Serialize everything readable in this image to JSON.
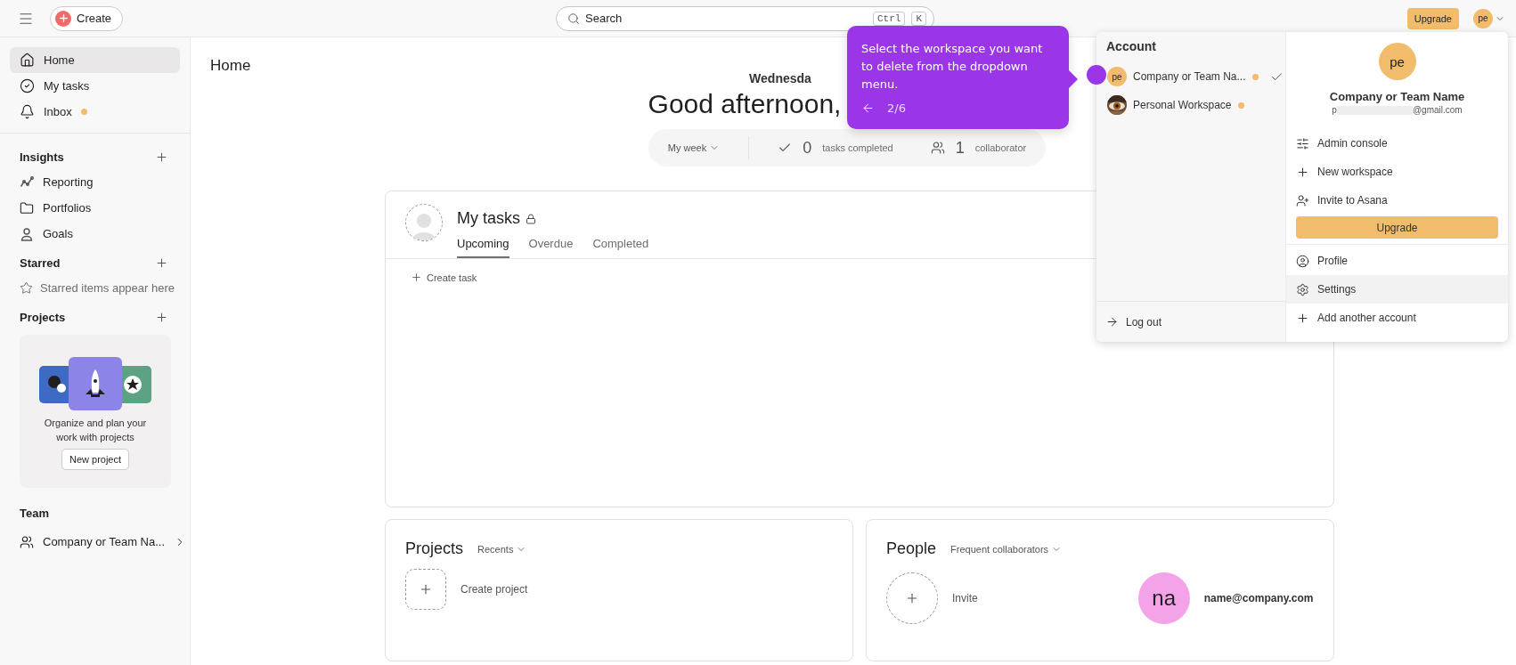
{
  "topbar": {
    "create": "Create",
    "search": {
      "placeholder": "Search",
      "keys": [
        "Ctrl",
        "K"
      ]
    },
    "upgrade": "Upgrade",
    "avatar": "pe"
  },
  "sidebar": {
    "nav": [
      {
        "label": "Home",
        "selected": true,
        "dot": false
      },
      {
        "label": "My tasks",
        "selected": false,
        "dot": false
      },
      {
        "label": "Inbox",
        "selected": false,
        "dot": true
      }
    ],
    "insights": {
      "title": "Insights",
      "items": [
        {
          "label": "Reporting"
        },
        {
          "label": "Portfolios"
        },
        {
          "label": "Goals"
        }
      ]
    },
    "starred": {
      "title": "Starred",
      "empty": "Starred items appear here"
    },
    "projects": {
      "title": "Projects",
      "promo": "Organize and plan your work with projects",
      "button": "New project"
    },
    "team": {
      "title": "Team",
      "item": "Company or Team Na..."
    }
  },
  "main": {
    "title": "Home",
    "date": "Wednesda",
    "greeting": "Good afternoon,",
    "stats": {
      "period": "My week",
      "tasks_count": "0",
      "tasks_label": "tasks completed",
      "collab_count": "1",
      "collab_label": "collaborator"
    }
  },
  "tasks_card": {
    "title": "My tasks",
    "tabs": [
      {
        "label": "Upcoming",
        "selected": true
      },
      {
        "label": "Overdue",
        "selected": false
      },
      {
        "label": "Completed",
        "selected": false
      }
    ],
    "create": "Create task"
  },
  "projects_card": {
    "title": "Projects",
    "filter": "Recents",
    "create": "Create project"
  },
  "people_card": {
    "title": "People",
    "filter": "Frequent collaborators",
    "invite": "Invite",
    "person": {
      "initials": "na",
      "email": "name@company.com"
    }
  },
  "account_menu": {
    "heading": "Account",
    "workspaces": [
      {
        "kind": "initials",
        "initials": "pe",
        "name": "Company or Team Na...",
        "dot": true,
        "checked": true
      },
      {
        "name": "Personal Workspace",
        "dot": true,
        "checked": false
      }
    ],
    "logout": "Log out",
    "profile": {
      "initials": "pe",
      "name": "Company or Team Name",
      "email_start": "p",
      "email_end": "@gmail.com"
    },
    "actions": [
      {
        "label": "Admin console"
      },
      {
        "label": "New workspace"
      },
      {
        "label": "Invite to Asana"
      }
    ],
    "upgrade": "Upgrade",
    "links": [
      {
        "label": "Profile",
        "selected": false
      },
      {
        "label": "Settings",
        "selected": true
      },
      {
        "label": "Add another account",
        "selected": false
      }
    ]
  },
  "tooltip": {
    "text": "Select the workspace you want to delete from the dropdown menu.",
    "step": "2/6"
  }
}
